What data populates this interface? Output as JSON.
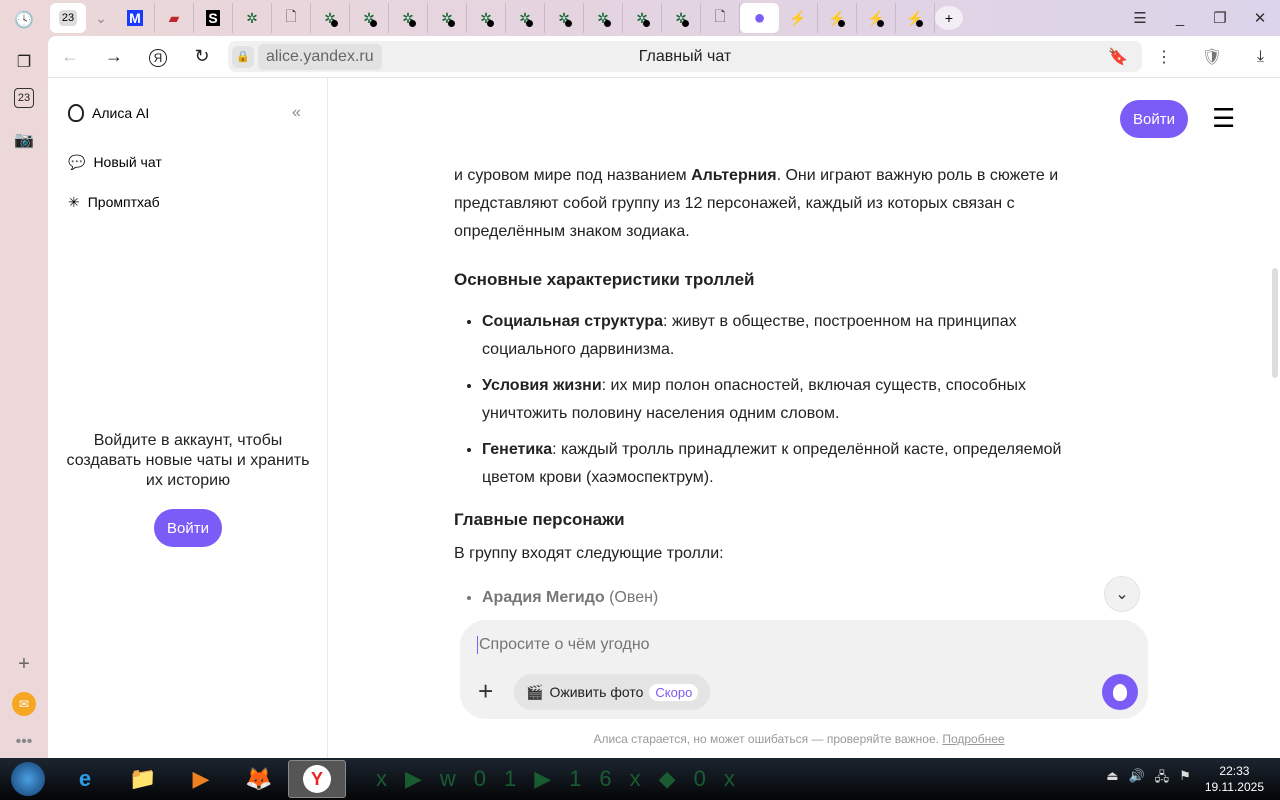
{
  "browser": {
    "side_icons": [
      "history-icon",
      "tabs-icon",
      "calendar-icon",
      "screenshot-icon"
    ],
    "calendar_day": "23",
    "tabs": [
      {
        "icon": "yandex-m-icon",
        "glyph": "M",
        "color": "#1a3bff"
      },
      {
        "icon": "book-icon",
        "glyph": "▰",
        "color": "#c0262c"
      },
      {
        "icon": "s-icon",
        "glyph": "S",
        "color": "#000"
      },
      {
        "icon": "bug-icon",
        "glyph": "✲",
        "color": "#163"
      },
      {
        "icon": "page-icon",
        "glyph": "🗋",
        "color": "#333"
      },
      {
        "icon": "bug-icon",
        "glyph": "✲",
        "color": "#163",
        "dot": true
      },
      {
        "icon": "bug-icon",
        "glyph": "✲",
        "color": "#163",
        "dot": true
      },
      {
        "icon": "bug-icon",
        "glyph": "✲",
        "color": "#163",
        "dot": true
      },
      {
        "icon": "bug-icon",
        "glyph": "✲",
        "color": "#163",
        "dot": true
      },
      {
        "icon": "bug-icon",
        "glyph": "✲",
        "color": "#163",
        "dot": true
      },
      {
        "icon": "bug-icon",
        "glyph": "✲",
        "color": "#163",
        "dot": true
      },
      {
        "icon": "bug-icon",
        "glyph": "✲",
        "color": "#163",
        "dot": true
      },
      {
        "icon": "bug-icon",
        "glyph": "✲",
        "color": "#163",
        "dot": true
      },
      {
        "icon": "bug-icon",
        "glyph": "✲",
        "color": "#163",
        "dot": true
      },
      {
        "icon": "bug-icon",
        "glyph": "✲",
        "color": "#163",
        "dot": true
      },
      {
        "icon": "page-icon",
        "glyph": "🗋",
        "color": "#333"
      },
      {
        "icon": "alice-icon",
        "glyph": "●",
        "color": "#7b5cf6",
        "active": true
      },
      {
        "icon": "lightning-icon",
        "glyph": "⚡",
        "color": "#f07a2b"
      },
      {
        "icon": "lightning-icon",
        "glyph": "⚡",
        "color": "#f07a2b",
        "dot": true
      },
      {
        "icon": "lightning-icon",
        "glyph": "⚡",
        "color": "#f07a2b",
        "dot": true
      },
      {
        "icon": "lightning-icon",
        "glyph": "⚡",
        "color": "#f07a2b",
        "dot": true
      }
    ],
    "url": "alice.yandex.ru",
    "page_title": "Главный чат"
  },
  "sidebar": {
    "app_name": "Алиса AI",
    "items": [
      {
        "label": "Новый чат",
        "icon": "chat-icon"
      },
      {
        "label": "Промптхаб",
        "icon": "sparkle-icon"
      }
    ],
    "login_prompt": "Войдите в аккаунт, чтобы создавать новые чаты и хранить их историю",
    "login_button": "Войти"
  },
  "header": {
    "login_button": "Войти"
  },
  "message": {
    "intro_pre": "и суровом мире под названием ",
    "intro_bold": "Альтерния",
    "intro_post": ". Они играют важную роль в сюжете и представляют собой группу из 12 персонажей, каждый из которых связан с определённым знаком зодиака.",
    "h1": "Основные характеристики троллей",
    "bullets": [
      {
        "bold": "Социальная структура",
        "text": ": живут в обществе, построенном на принципах социального дарвинизма."
      },
      {
        "bold": "Условия жизни",
        "text": ": их мир полон опасностей, включая существ, способных уничтожить половину населения одним словом."
      },
      {
        "bold": "Генетика",
        "text": ": каждый тролль принадлежит к определённой касте, определяемой цветом крови (хаэмоспектрум)."
      }
    ],
    "h2": "Главные персонажи",
    "p2": "В группу входят следующие тролли:",
    "chars": [
      {
        "bold": "Арадия Мегидо",
        "text": " (Овен)"
      }
    ]
  },
  "input": {
    "placeholder": "Спросите о чём угодно",
    "animate_label": "Оживить фото",
    "badge": "Скоро"
  },
  "footer": {
    "disclaimer": "Алиса старается, но может ошибаться — проверяйте важное.",
    "link": "Подробнее"
  },
  "taskbar": {
    "time": "22:33",
    "date": "19.11.2025"
  },
  "colors": {
    "accent": "#7b5cf6"
  }
}
